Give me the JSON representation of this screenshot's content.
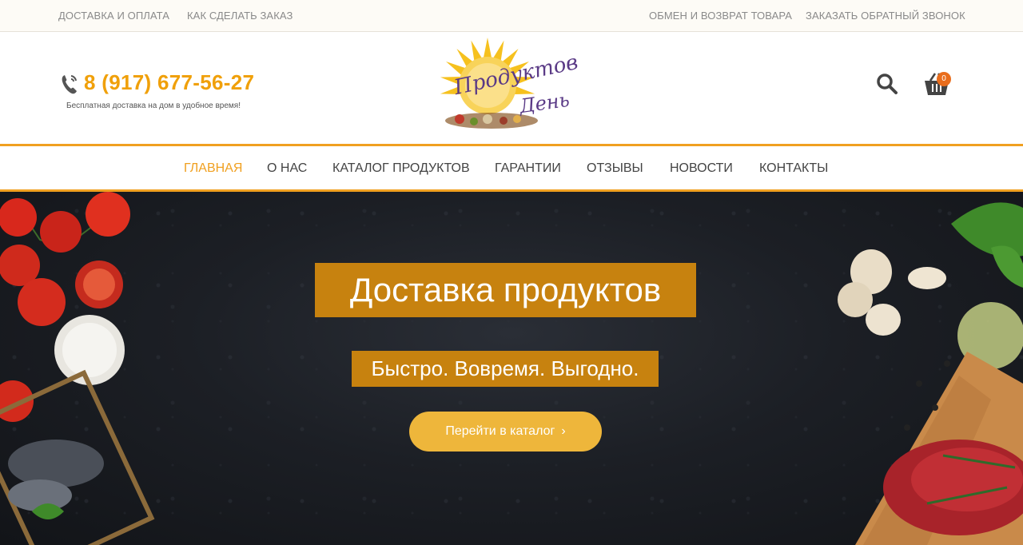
{
  "topbar": {
    "delivery": "ДОСТАВКА И ОПЛАТА",
    "how_to_order": "КАК СДЕЛАТЬ ЗАКАЗ",
    "exchange": "ОБМЕН И ВОЗВРАТ ТОВАРА",
    "callback": "ЗАКАЗАТЬ ОБРАТНЫЙ ЗВОНОК"
  },
  "header": {
    "phone": "8 (917) 677-56-27",
    "tagline": "Бесплатная доставка на дом в удобное время!",
    "logo_line1": "Продуктов",
    "logo_line2": "День",
    "cart_count": "0",
    "icons": [
      "phone-icon",
      "search-icon",
      "cart-icon"
    ]
  },
  "nav": {
    "items": [
      {
        "label": "ГЛАВНАЯ",
        "active": true
      },
      {
        "label": "О НАС"
      },
      {
        "label": "КАТАЛОГ ПРОДУКТОВ"
      },
      {
        "label": "ГАРАНТИИ"
      },
      {
        "label": "ОТЗЫВЫ"
      },
      {
        "label": "НОВОСТИ"
      },
      {
        "label": "КОНТАКТЫ"
      }
    ]
  },
  "hero": {
    "title": "Доставка продуктов",
    "subtitle": "Быстро. Вовремя. Выгодно.",
    "button": "Перейти в каталог",
    "button_icon": "›"
  },
  "colors": {
    "accent": "#f0a020",
    "phone": "#f0a00a",
    "banner": "#c7820f",
    "button": "#eeb63b",
    "badge": "#e96d1c"
  }
}
